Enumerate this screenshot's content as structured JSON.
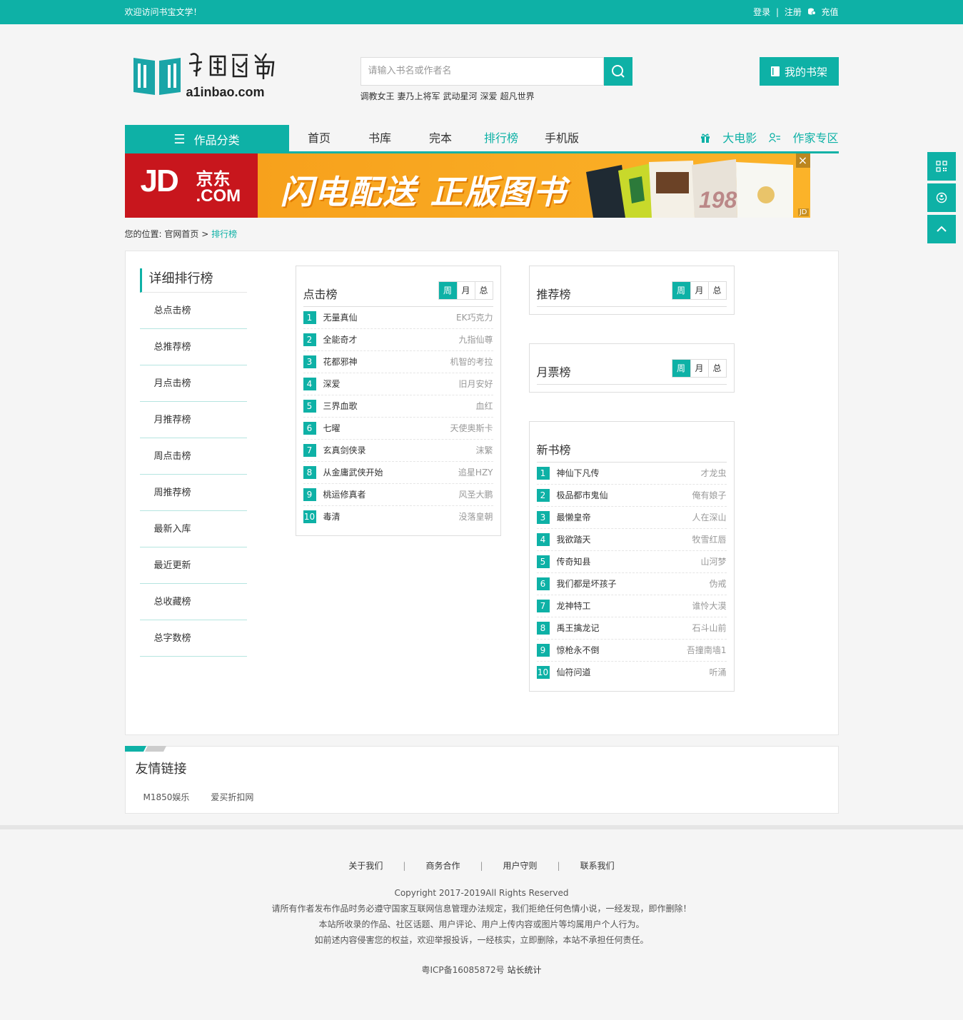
{
  "topbar": {
    "welcome": "欢迎访问书宝文学！",
    "login": "登录",
    "divider": "|",
    "register": "注册",
    "recharge": "充值"
  },
  "header": {
    "logo_text": "a1inbao.com",
    "search_placeholder": "请输入书名或作者名",
    "hot_words": [
      "调教女王",
      "妻乃上将军",
      "武动星河",
      "深爱",
      "超凡世界"
    ],
    "shelf_label": "我的书架"
  },
  "nav": {
    "category_label": "作品分类",
    "links": [
      "首页",
      "书库",
      "完本",
      "排行榜",
      "手机版"
    ],
    "active_index": 3,
    "movie_label": "大电影",
    "author_label": "作家专区"
  },
  "banner": {
    "brand": "JD",
    "brand_cn": "京东",
    "brand_com": ".COM",
    "slogan": "闪电配送 正版图书",
    "book_year": "1988",
    "tag": "JD"
  },
  "breadcrumb": {
    "prefix": "您的位置:",
    "home": "官网首页",
    "sep": ">",
    "current": "排行榜"
  },
  "sidebar": {
    "title": "详细排行榜",
    "items": [
      "总点击榜",
      "总推荐榜",
      "月点击榜",
      "月推荐榜",
      "周点击榜",
      "周推荐榜",
      "最新入库",
      "最近更新",
      "总收藏榜",
      "总字数榜"
    ]
  },
  "tabs": [
    "周",
    "月",
    "总"
  ],
  "click_rank": {
    "title": "点击榜",
    "rows": [
      {
        "num": "1",
        "book": "无量真仙",
        "author": "EK巧克力"
      },
      {
        "num": "2",
        "book": "全能奇才",
        "author": "九指仙尊"
      },
      {
        "num": "3",
        "book": "花都邪神",
        "author": "机智的考拉"
      },
      {
        "num": "4",
        "book": "深爱",
        "author": "旧月安好"
      },
      {
        "num": "5",
        "book": "三界血歌",
        "author": "血红"
      },
      {
        "num": "6",
        "book": "七曜",
        "author": "天使奥斯卡"
      },
      {
        "num": "7",
        "book": "玄真剑侠录",
        "author": "沫繁"
      },
      {
        "num": "8",
        "book": "从金庸武侠开始",
        "author": "追星HZY"
      },
      {
        "num": "9",
        "book": "桃运修真者",
        "author": "风圣大鹏"
      },
      {
        "num": "10",
        "book": "毒清",
        "author": "没落皇朝"
      }
    ]
  },
  "recommend_rank": {
    "title": "推荐榜"
  },
  "monthly_rank": {
    "title": "月票榜"
  },
  "new_rank": {
    "title": "新书榜",
    "rows": [
      {
        "num": "1",
        "book": "神仙下凡传",
        "author": "才龙虫"
      },
      {
        "num": "2",
        "book": "极品都市鬼仙",
        "author": "俺有娘子"
      },
      {
        "num": "3",
        "book": "最懒皇帝",
        "author": "人在深山"
      },
      {
        "num": "4",
        "book": "我欲踏天",
        "author": "牧雪红唇"
      },
      {
        "num": "5",
        "book": "传奇知县",
        "author": "山河梦"
      },
      {
        "num": "6",
        "book": "我们都是坏孩子",
        "author": "伪戒"
      },
      {
        "num": "7",
        "book": "龙神特工",
        "author": "谁怜大漠"
      },
      {
        "num": "8",
        "book": "禹王擒龙记",
        "author": "石斗山前"
      },
      {
        "num": "9",
        "book": "惊枪永不倒",
        "author": "吾撞南墙1"
      },
      {
        "num": "10",
        "book": "仙符问道",
        "author": "听涌"
      }
    ]
  },
  "friends": {
    "title": "友情链接",
    "links": [
      "M1850娱乐",
      "爱买折扣网"
    ]
  },
  "footer": {
    "links": [
      "关于我们",
      "商务合作",
      "用户守则",
      "联系我们"
    ],
    "sep": "|",
    "copyright": "Copyright 2017-2019All Rights Reserved",
    "notice1": "请所有作者发布作品时务必遵守国家互联网信息管理办法规定，我们拒绝任何色情小说，一经发现，即作删除！",
    "notice2": "本站所收录的作品、社区话题、用户评论、用户上传内容或图片等均属用户个人行为。",
    "notice3": "如前述内容侵害您的权益，欢迎举报投诉，一经核实，立即删除，本站不承担任何责任。",
    "icp": "粤ICP备16085872号",
    "stat": "站长统计"
  },
  "colors": {
    "accent": "#0eb1a6",
    "jd_red": "#c8161d",
    "banner_orange": "#f7a11c"
  }
}
